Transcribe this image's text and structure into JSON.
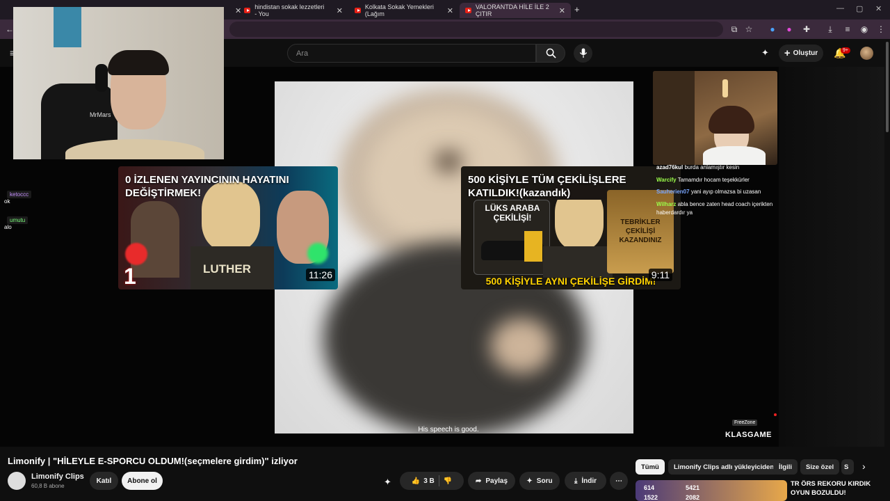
{
  "browser": {
    "tabs": [
      {
        "title": "hindistan sokak lezzetleri - You"
      },
      {
        "title": "Kolkata Sokak Yemekleri (Lağım"
      },
      {
        "title": "VALORANTDA HİLE İLE 2 ÇITIR"
      }
    ],
    "new_tab": "+"
  },
  "header": {
    "search_placeholder": "Ara",
    "create_label": "Oluştur",
    "notif_count": "9+"
  },
  "stream": {
    "webcam_label": "MrMars",
    "subtitle": "His speech is good.",
    "left_chat": [
      {
        "name": "ketoccc",
        "name_color": "#c792ff",
        "msg": "ok"
      },
      {
        "name": "umutu",
        "name_color": "#7cff7c",
        "msg": "alo"
      }
    ],
    "right_chat": [
      {
        "name": "azad76kul",
        "name_color": "#ffffff",
        "msg": "burda anlamıştır kesin"
      },
      {
        "name": "Warcify",
        "name_color": "#9cff4a",
        "msg": "Tamamdır hocam teşekkürler"
      },
      {
        "name": "Sauherien07",
        "name_color": "#7aa6ff",
        "msg": "yani ayıp olmazsa bi uzasan"
      },
      {
        "name": "Wilharz",
        "name_color": "#9cff4a",
        "msg": "abla bence zaten head coach içerikten haberdardır ya"
      }
    ],
    "thumb1": {
      "title": "0 İZLENEN YAYINCININ HAYATINI DEĞİŞTİRMEK!",
      "center_label": "LUTHER",
      "duration": "11:26"
    },
    "thumb2": {
      "title": "500 KİŞİYLE TÜM ÇEKİLİŞLERE KATILDIK!(kazandık)",
      "sign": "LÜKS ARABA ÇEKİLİŞİ!",
      "cert": "TEBRİKLER ÇEKİLİŞİ KAZANDINIZ",
      "bottom": "500 KİŞİYLE AYNI ÇEKİLİŞE GİRDİM!",
      "duration": "9:11"
    },
    "sponsor_top": "FreeZone",
    "sponsor": "KLASGAME"
  },
  "video": {
    "title": "Limonify | \"HİLEYLE E-SPORCU OLDUM!(seçmelere girdim)\" izliyor",
    "channel": "Limonify Clips",
    "subscribers": "60,8 B abone",
    "join_label": "Katıl",
    "subscribe_label": "Abone ol",
    "like_count": "3 B",
    "share_label": "Paylaş",
    "ask_label": "Soru",
    "download_label": "İndir"
  },
  "chips": [
    "Tümü",
    "Limonify Clips adlı yükleyiciden",
    "İlgili",
    "Size özel",
    "S"
  ],
  "side_video": {
    "title": "TR ÖRS REKORU KIRDIK OYUN BOZULDU!",
    "stats": [
      "614",
      "5421",
      "1522",
      "2082"
    ]
  }
}
